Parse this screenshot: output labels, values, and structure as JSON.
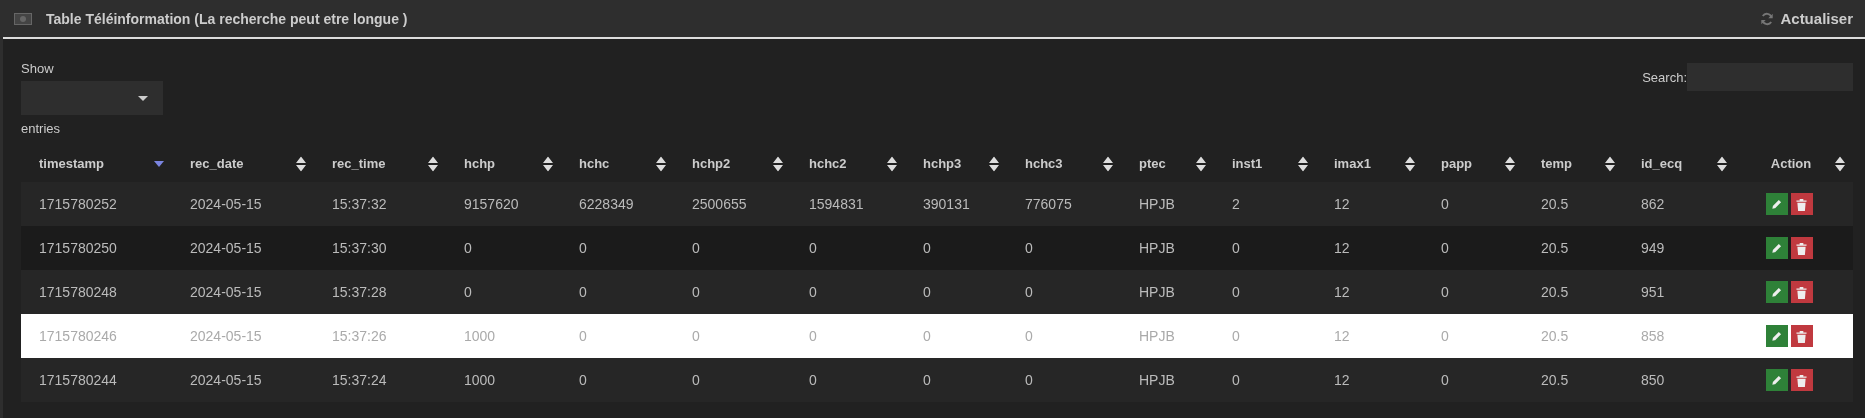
{
  "panel": {
    "title": "Table Téléinformation (La recherche peut etre longue )",
    "refresh_label": "Actualiser"
  },
  "length_control": {
    "label_before": "Show",
    "label_after": "entries"
  },
  "search": {
    "label": "Search:"
  },
  "table": {
    "columns": [
      {
        "label": "timestamp",
        "sorted": true
      },
      {
        "label": "rec_date",
        "sorted": false
      },
      {
        "label": "rec_time",
        "sorted": false
      },
      {
        "label": "hchp",
        "sorted": false
      },
      {
        "label": "hchc",
        "sorted": false
      },
      {
        "label": "hchp2",
        "sorted": false
      },
      {
        "label": "hchc2",
        "sorted": false
      },
      {
        "label": "hchp3",
        "sorted": false
      },
      {
        "label": "hchc3",
        "sorted": false
      },
      {
        "label": "ptec",
        "sorted": false
      },
      {
        "label": "inst1",
        "sorted": false
      },
      {
        "label": "imax1",
        "sorted": false
      },
      {
        "label": "papp",
        "sorted": false
      },
      {
        "label": "temp",
        "sorted": false
      },
      {
        "label": "id_ecq",
        "sorted": false
      },
      {
        "label": "Action",
        "sorted": false
      }
    ],
    "rows": [
      {
        "hovered": false,
        "cells": [
          "1715780252",
          "2024-05-15",
          "15:37:32",
          "9157620",
          "6228349",
          "2500655",
          "1594831",
          "390131",
          "776075",
          "HPJB",
          "2",
          "12",
          "0",
          "20.5",
          "862"
        ]
      },
      {
        "hovered": false,
        "cells": [
          "1715780250",
          "2024-05-15",
          "15:37:30",
          "0",
          "0",
          "0",
          "0",
          "0",
          "0",
          "HPJB",
          "0",
          "12",
          "0",
          "20.5",
          "949"
        ]
      },
      {
        "hovered": false,
        "cells": [
          "1715780248",
          "2024-05-15",
          "15:37:28",
          "0",
          "0",
          "0",
          "0",
          "0",
          "0",
          "HPJB",
          "0",
          "12",
          "0",
          "20.5",
          "951"
        ]
      },
      {
        "hovered": true,
        "cells": [
          "1715780246",
          "2024-05-15",
          "15:37:26",
          "1000",
          "0",
          "0",
          "0",
          "0",
          "0",
          "HPJB",
          "0",
          "12",
          "0",
          "20.5",
          "858"
        ]
      },
      {
        "hovered": false,
        "cells": [
          "1715780244",
          "2024-05-15",
          "15:37:24",
          "1000",
          "0",
          "0",
          "0",
          "0",
          "0",
          "HPJB",
          "0",
          "12",
          "0",
          "20.5",
          "850"
        ]
      }
    ]
  }
}
